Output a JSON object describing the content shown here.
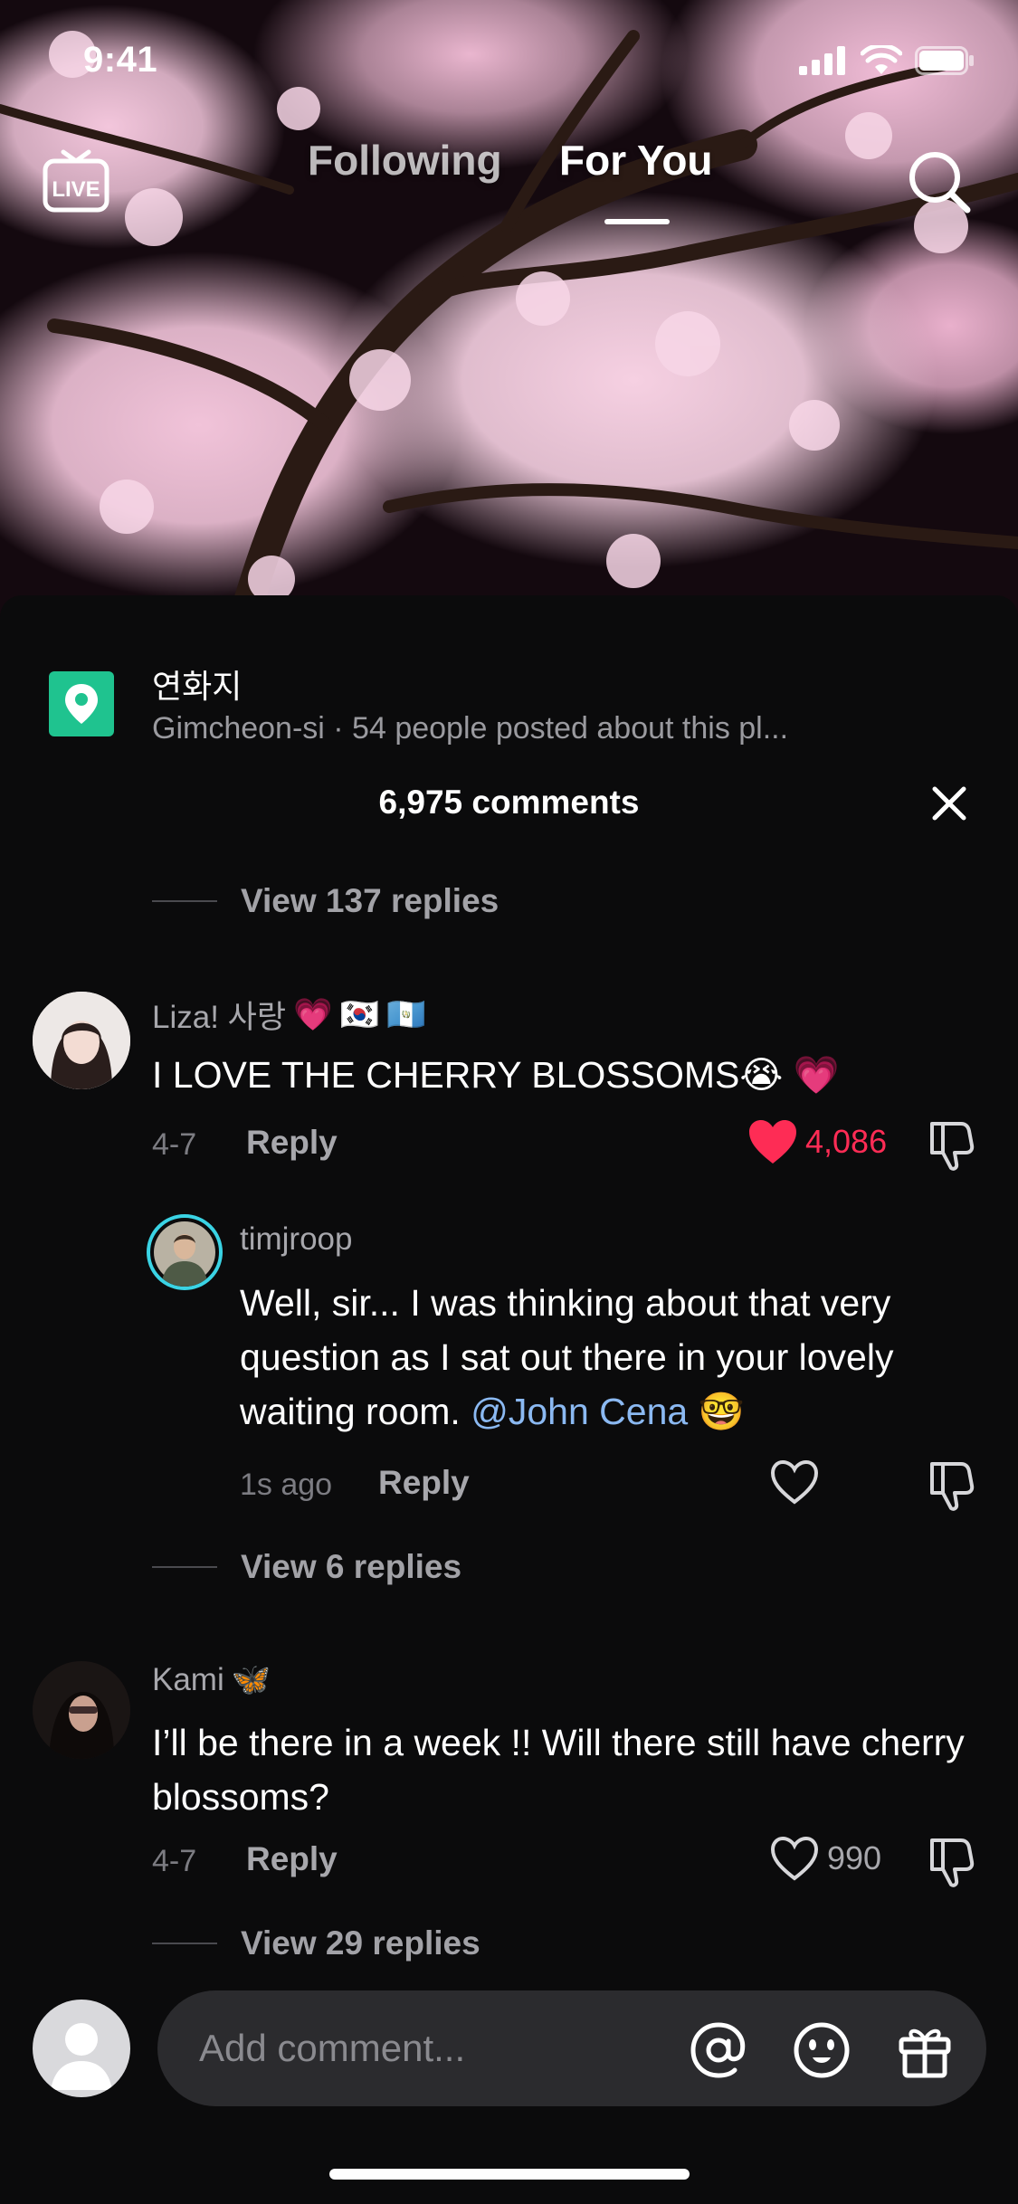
{
  "status_bar": {
    "time": "9:41"
  },
  "top_nav": {
    "live_label": "LIVE",
    "tabs": [
      {
        "label": "Following",
        "active": false
      },
      {
        "label": "For You",
        "active": true
      }
    ]
  },
  "location": {
    "name": "연화지",
    "subtitle": "Gimcheon-si · 54 people posted about this pl..."
  },
  "comments_panel": {
    "count_label": "6,975 comments",
    "view_replies_top": "View 137 replies",
    "comments": [
      {
        "username": "Liza! 사랑",
        "username_emojis": [
          "💗",
          "🇰🇷",
          "🇬🇹"
        ],
        "text": "I LOVE THE CHERRY BLOSSOMS",
        "text_emojis": [
          "😭",
          "💗"
        ],
        "date": "4-7",
        "reply_label": "Reply",
        "likes": "4,086",
        "liked": true
      },
      {
        "username": "timjroop",
        "text_before_mention": "Well, sir... I was thinking about that very question as I sat out there in your lovely waiting room.",
        "mention": "@John Cena",
        "text_emoji": "🤓",
        "date": "1s ago",
        "reply_label": "Reply",
        "likes": "",
        "liked": false
      },
      {
        "username": "Kami",
        "username_emoji": "🦋",
        "text": "I’ll be there in a week !! Will there still have cherry blossoms?",
        "date": "4-7",
        "reply_label": "Reply",
        "likes": "990",
        "liked": false
      }
    ],
    "view_replies_mid": "View 6 replies",
    "view_replies_bottom": "View 29 replies"
  },
  "input": {
    "placeholder": "Add comment..."
  },
  "colors": {
    "accent_like": "#fe2c55",
    "mention": "#8bb9f2",
    "location_pin": "#1fc38f",
    "sheet_bg": "#0b0b0c"
  },
  "icons": [
    "live-icon",
    "search-icon",
    "location-pin-icon",
    "close-icon",
    "heart-icon",
    "dislike-icon",
    "at-icon",
    "emoji-icon",
    "gift-icon"
  ]
}
